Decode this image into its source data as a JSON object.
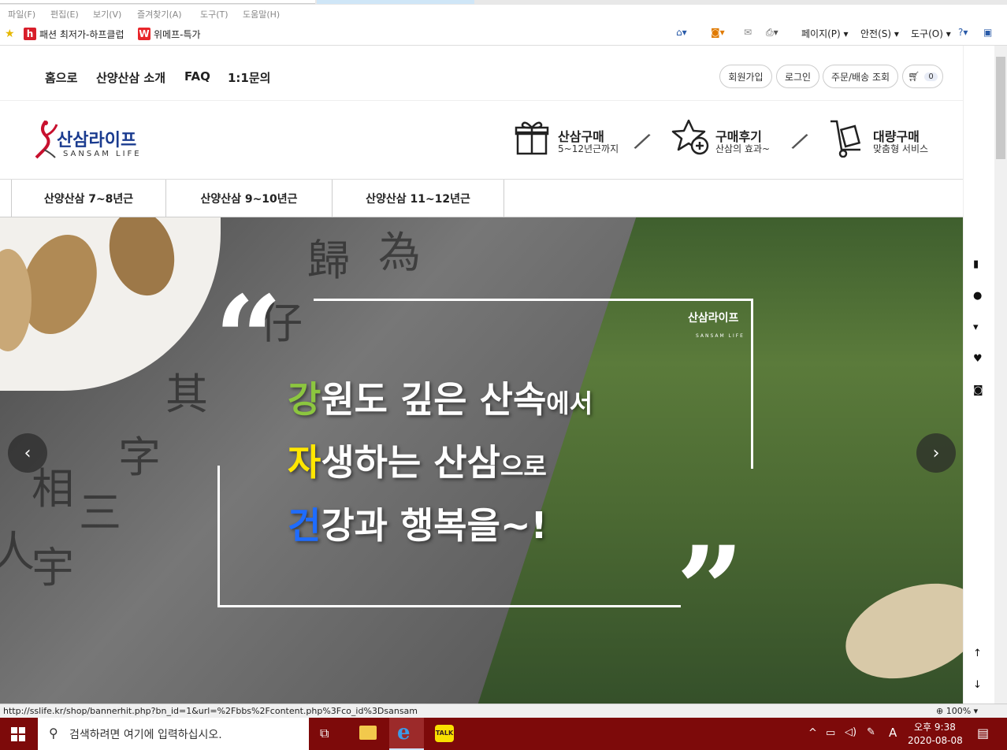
{
  "menubar": [
    "파일(F)",
    "편집(E)",
    "보기(V)",
    "즐겨찾기(A)",
    "도구(T)",
    "도움말(H)"
  ],
  "favorites": [
    {
      "label": "패션 최저가-하프클럽",
      "icon": "halfclub-logo-icon",
      "color": "#d81e2a",
      "letter": "h"
    },
    {
      "label": "위메프-특가",
      "icon": "wemakeprice-logo-icon",
      "color": "#e8262b",
      "letter": "W"
    }
  ],
  "commandbar": {
    "page": "페이지(P)",
    "safety": "안전(S)",
    "tools": "도구(O)"
  },
  "topnav": {
    "items": [
      "홈으로",
      "산양산삼 소개",
      "FAQ",
      "1:1문의"
    ]
  },
  "account": {
    "signup": "회원가입",
    "login": "로그인",
    "order": "주문/배송 조회",
    "cart_count": "0"
  },
  "logo": {
    "text": "산삼라이프",
    "sub": "SANSAM LIFE"
  },
  "services": [
    {
      "title": "산삼구매",
      "sub": "5~12년근까지",
      "icon": "gift-icon"
    },
    {
      "title": "구매후기",
      "sub": "산삼의 효과~",
      "icon": "star-plus-icon"
    },
    {
      "title": "대량구매",
      "sub": "맞춤형 서비스",
      "icon": "cart-dolly-icon"
    }
  ],
  "categories": [
    "산양산삼 7~8년근",
    "산양산삼 9~10년근",
    "산양산삼 11~12년근"
  ],
  "banner": {
    "line1_accent": "강",
    "line1_main": "원도 깊은 산속",
    "line1_small": "에서",
    "line2_accent": "자",
    "line2_main": "생하는 산삼",
    "line2_small": "으로",
    "line3_accent": "건",
    "line3_main": "강과 행복을~!",
    "logo_text": "산삼라이프",
    "logo_sub": "SANSAM LIFE",
    "colors": {
      "accent1": "#8cc63f",
      "accent2": "#ffe600",
      "accent3": "#1e6cff"
    }
  },
  "statusbar": {
    "url": "http://sslife.kr/shop/bannerhit.php?bn_id=1&url=%2Fbbs%2Fcontent.php%3Fco_id%3Dsansam",
    "zoom": "100%"
  },
  "taskbar": {
    "search_placeholder": "검색하려면 여기에 입력하십시오.",
    "time": "오후 9:38",
    "date": "2020-08-08",
    "ime": "A"
  }
}
